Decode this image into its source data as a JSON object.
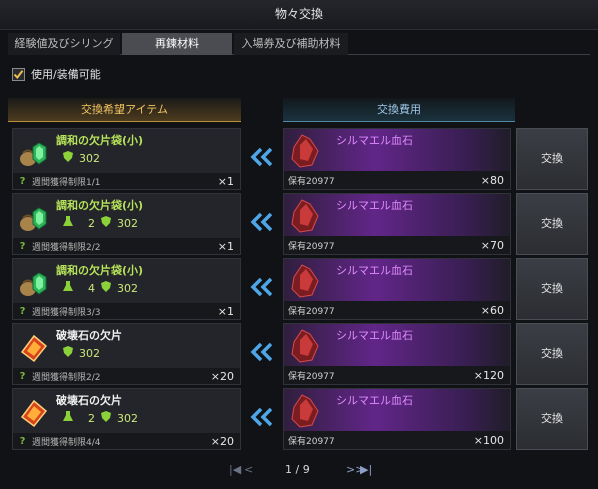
{
  "window": {
    "title": "物々交換"
  },
  "tabs": [
    {
      "label": "経験値及びシリング"
    },
    {
      "label": "再鍊材料",
      "active": true
    },
    {
      "label": "入場券及び補助材料"
    }
  ],
  "filter": {
    "label": "使用/装備可能",
    "checked": true
  },
  "headers": {
    "wanted": "交換希望アイテム",
    "cost": "交換費用"
  },
  "rows": [
    {
      "name": "調和の欠片袋(小)",
      "name_color": "#b7e35a",
      "icon": "harmony-pouch-icon",
      "stat1": "",
      "stat2": "302",
      "limit": "週間獲得制限1/1",
      "qty": "×1",
      "cost_name": "シルマエル血石",
      "owned": "保有20977",
      "cost_qty": "×80",
      "button": "交換"
    },
    {
      "name": "調和の欠片袋(小)",
      "name_color": "#b7e35a",
      "icon": "harmony-pouch-icon",
      "stat1": "2",
      "stat2": "302",
      "limit": "週間獲得制限2/2",
      "qty": "×1",
      "cost_name": "シルマエル血石",
      "owned": "保有20977",
      "cost_qty": "×70",
      "button": "交換"
    },
    {
      "name": "調和の欠片袋(小)",
      "name_color": "#b7e35a",
      "icon": "harmony-pouch-icon",
      "stat1": "4",
      "stat2": "302",
      "limit": "週間獲得制限3/3",
      "qty": "×1",
      "cost_name": "シルマエル血石",
      "owned": "保有20977",
      "cost_qty": "×60",
      "button": "交換"
    },
    {
      "name": "破壊石の欠片",
      "name_color": "#f0f0f0",
      "icon": "destruction-stone-icon",
      "stat1": "",
      "stat2": "302",
      "limit": "週間獲得制限2/2",
      "qty": "×20",
      "cost_name": "シルマエル血石",
      "owned": "保有20977",
      "cost_qty": "×120",
      "button": "交換"
    },
    {
      "name": "破壊石の欠片",
      "name_color": "#f0f0f0",
      "icon": "destruction-stone-icon",
      "stat1": "2",
      "stat2": "302",
      "limit": "週間獲得制限4/4",
      "qty": "×20",
      "cost_name": "シルマエル血石",
      "owned": "保有20977",
      "cost_qty": "×100",
      "button": "交換"
    }
  ],
  "pagination": {
    "text": "1 / 9"
  }
}
